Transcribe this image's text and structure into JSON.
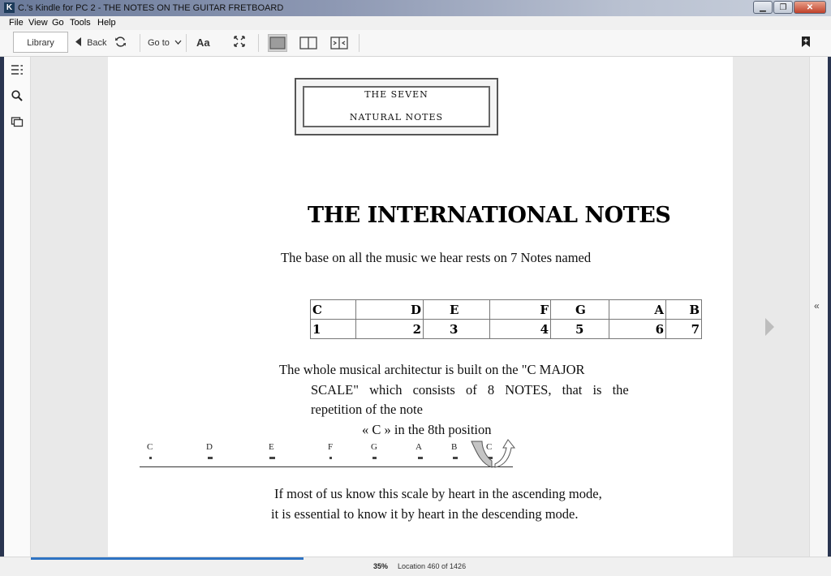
{
  "window": {
    "title": "C.'s Kindle for PC 2 - THE NOTES ON THE GUITAR FRETBOARD",
    "app_icon_letter": "K"
  },
  "menu": [
    "File",
    "View",
    "Go",
    "Tools",
    "Help"
  ],
  "toolbar": {
    "library": "Library",
    "back": "Back",
    "goto": "Go to",
    "font": "Aa"
  },
  "book": {
    "frame_line1": "THE SEVEN",
    "frame_line2": "NATURAL NOTES",
    "heading": "THE INTERNATIONAL NOTES",
    "intro": "The base on all the music we hear rests on 7 Notes named",
    "notes_table": [
      [
        "C",
        "D",
        "E",
        "F",
        "G",
        "A",
        "B"
      ],
      [
        "1",
        "2",
        "3",
        "4",
        "5",
        "6",
        "7"
      ]
    ],
    "para2_line1": "The whole musical architectur is built on the \"C MAJOR",
    "para2_line2": "SCALE\" which consists of 8 NOTES, that is the",
    "para2_line3": "repetition of the note",
    "para2_line4": "« C » in the 8th position",
    "scale_letters": [
      "C",
      "D",
      "E",
      "F",
      "G",
      "A",
      "B",
      "C"
    ],
    "para3_line1": "If most of us know this scale by heart in the ascending mode,",
    "para3_line2": "it is essential to know it by heart in the descending mode."
  },
  "sidebar": {
    "collapse_glyph": "«"
  },
  "status": {
    "percent": "35%",
    "progress_value": 0.35,
    "location": "Location 460 of 1426"
  },
  "colors": {
    "progress": "#2e73c3",
    "page": "#ffffff",
    "content_bg": "#e9e9e9"
  }
}
